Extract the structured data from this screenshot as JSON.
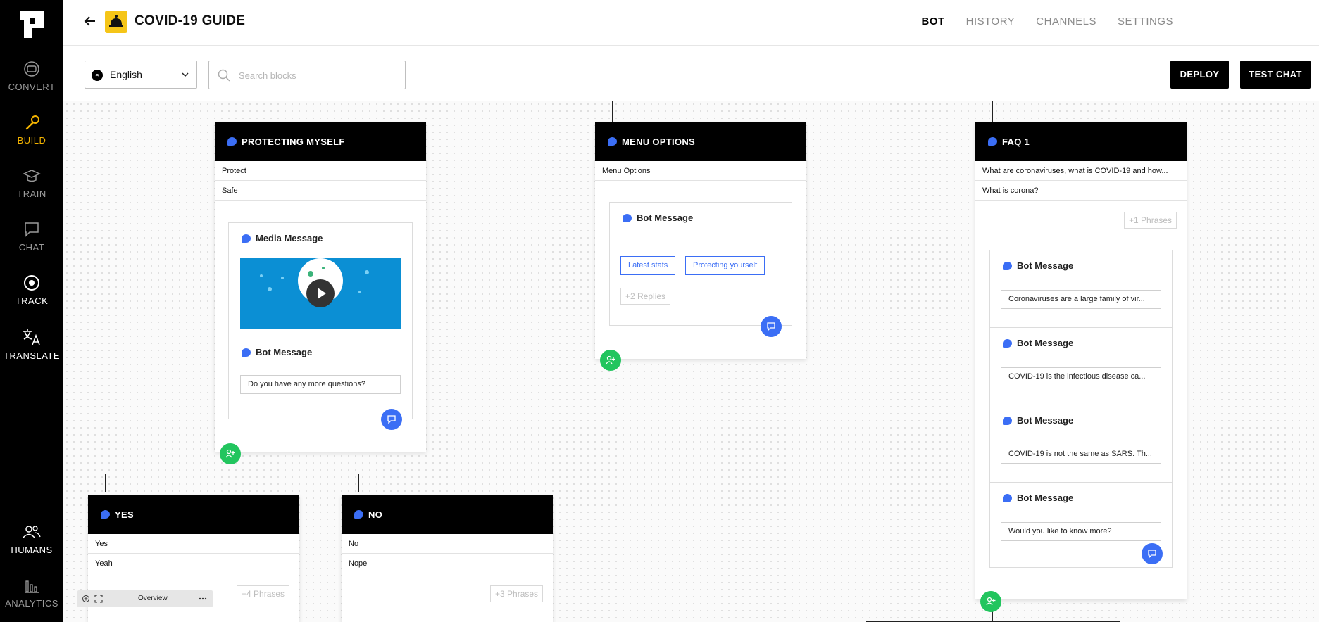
{
  "sidebar": {
    "items": [
      {
        "label": "CONVERT",
        "icon": "convert-icon"
      },
      {
        "label": "BUILD",
        "icon": "wrench-icon"
      },
      {
        "label": "TRAIN",
        "icon": "graduation-cap-icon"
      },
      {
        "label": "CHAT",
        "icon": "chat-bubble-icon"
      },
      {
        "label": "TRACK",
        "icon": "track-target-icon"
      },
      {
        "label": "TRANSLATE",
        "icon": "translate-icon"
      },
      {
        "label": "HUMANS",
        "icon": "humans-icon"
      },
      {
        "label": "ANALYTICS",
        "icon": "bar-chart-icon"
      }
    ],
    "active": "BUILD"
  },
  "header": {
    "title": "COVID-19 GUIDE",
    "tabs": [
      "BOT",
      "HISTORY",
      "CHANNELS",
      "SETTINGS"
    ],
    "active_tab": "BOT"
  },
  "toolbar": {
    "language": "English",
    "language_badge": "e",
    "search_placeholder": "Search blocks",
    "deploy_label": "DEPLOY",
    "test_chat_label": "TEST CHAT"
  },
  "colors": {
    "accent_blue": "#3b6ef5",
    "active_yellow": "#f4b400",
    "add_green": "#22c55e",
    "media_blue": "#0b8fd4"
  },
  "blocks": {
    "protecting": {
      "title": "PROTECTING MYSELF",
      "phrases": [
        "Protect",
        "Safe"
      ],
      "media_title": "Media Message",
      "bot_title": "Bot Message",
      "bot_text": "Do you have any more questions?"
    },
    "menu": {
      "title": "MENU OPTIONS",
      "phrases": [
        "Menu Options"
      ],
      "bot_title": "Bot Message",
      "replies": [
        "Latest stats",
        "Protecting yourself"
      ],
      "more_replies": "+2 Replies"
    },
    "faq": {
      "title": "FAQ 1",
      "phrases": [
        "What are coronaviruses, what is COVID-19 and how...",
        "What is corona?"
      ],
      "more_phrases": "+1 Phrases",
      "messages": [
        {
          "title": "Bot Message",
          "text": "Coronaviruses are a large family of vir..."
        },
        {
          "title": "Bot Message",
          "text": "COVID-19 is the infectious disease ca..."
        },
        {
          "title": "Bot Message",
          "text": "COVID-19 is not the same as SARS. Th..."
        },
        {
          "title": "Bot Message",
          "text": "Would you like to know more?"
        }
      ]
    },
    "yes": {
      "title": "YES",
      "phrases": [
        "Yes",
        "Yeah"
      ],
      "more_phrases": "+4 Phrases"
    },
    "no": {
      "title": "NO",
      "phrases": [
        "No",
        "Nope"
      ],
      "more_phrases": "+3 Phrases"
    }
  },
  "overview": {
    "label": "Overview"
  }
}
